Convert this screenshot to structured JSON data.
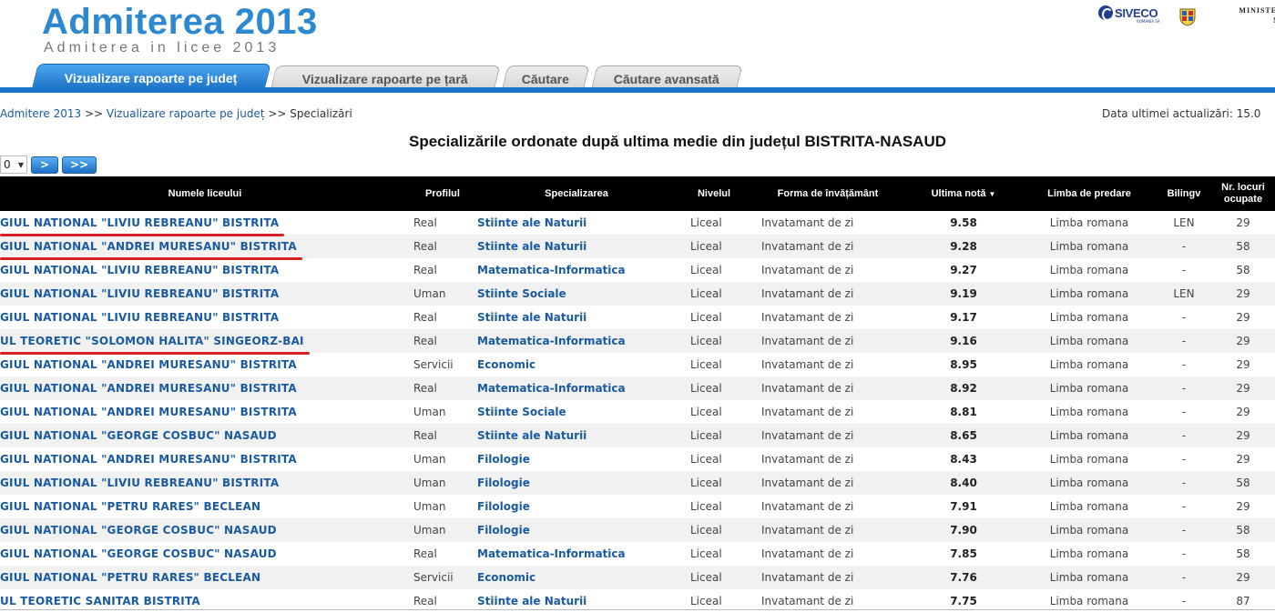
{
  "header": {
    "title": "Admiterea 2013",
    "subtitle": "Admiterea in licee 2013",
    "siveco": "SIVECO",
    "siveco_small": "ROMANIA SA",
    "ministry_line1": "MINISTERUL",
    "ministry_line2": "NAȚI"
  },
  "tabs": [
    {
      "label": "Vizualizare rapoarte pe județ",
      "active": true
    },
    {
      "label": "Vizualizare rapoarte pe țară",
      "active": false
    },
    {
      "label": "Căutare",
      "active": false
    },
    {
      "label": "Căutare avansată",
      "active": false
    }
  ],
  "breadcrumb": {
    "item1": "Admitere 2013",
    "sep": ">>",
    "item2": "Vizualizare rapoarte pe județ",
    "item3": "Specializări"
  },
  "last_update": "Data ultimei actualizări: 15.0",
  "heading": "Specializările ordonate după ultima medie din județul BISTRITA-NASAUD",
  "pager": {
    "page_value": "0",
    "next_label": ">",
    "last_label": ">>"
  },
  "table": {
    "headers": {
      "school": "Numele liceului",
      "profil": "Profilul",
      "spec": "Specializarea",
      "nivel": "Nivelul",
      "forma": "Forma de învățământ",
      "nota": "Ultima notă",
      "limba": "Limba de predare",
      "bilingv": "Bilingv",
      "locuri": "Nr. locuri ocupate"
    },
    "rows": [
      {
        "school": "GIUL NATIONAL \"LIVIU REBREANU\" BISTRITA",
        "profil": "Real",
        "spec": "Stiinte ale Naturii",
        "nivel": "Liceal",
        "forma": "Invatamant de zi",
        "nota": "9.58",
        "limba": "Limba romana",
        "bilingv": "LEN",
        "locuri": "29",
        "underlined": true
      },
      {
        "school": "GIUL NATIONAL \"ANDREI MURESANU\" BISTRITA",
        "profil": "Real",
        "spec": "Stiinte ale Naturii",
        "nivel": "Liceal",
        "forma": "Invatamant de zi",
        "nota": "9.28",
        "limba": "Limba romana",
        "bilingv": "-",
        "locuri": "58",
        "underlined": true
      },
      {
        "school": "GIUL NATIONAL \"LIVIU REBREANU\" BISTRITA",
        "profil": "Real",
        "spec": "Matematica-Informatica",
        "nivel": "Liceal",
        "forma": "Invatamant de zi",
        "nota": "9.27",
        "limba": "Limba romana",
        "bilingv": "-",
        "locuri": "58",
        "underlined": false
      },
      {
        "school": "GIUL NATIONAL \"LIVIU REBREANU\" BISTRITA",
        "profil": "Uman",
        "spec": "Stiinte Sociale",
        "nivel": "Liceal",
        "forma": "Invatamant de zi",
        "nota": "9.19",
        "limba": "Limba romana",
        "bilingv": "LEN",
        "locuri": "29",
        "underlined": false
      },
      {
        "school": "GIUL NATIONAL \"LIVIU REBREANU\" BISTRITA",
        "profil": "Real",
        "spec": "Stiinte ale Naturii",
        "nivel": "Liceal",
        "forma": "Invatamant de zi",
        "nota": "9.17",
        "limba": "Limba romana",
        "bilingv": "-",
        "locuri": "29",
        "underlined": false
      },
      {
        "school": "UL TEORETIC \"SOLOMON HALITA\" SINGEORZ-BAI",
        "profil": "Real",
        "spec": "Matematica-Informatica",
        "nivel": "Liceal",
        "forma": "Invatamant de zi",
        "nota": "9.16",
        "limba": "Limba romana",
        "bilingv": "-",
        "locuri": "29",
        "underlined": true
      },
      {
        "school": "GIUL NATIONAL \"ANDREI MURESANU\" BISTRITA",
        "profil": "Servicii",
        "spec": "Economic",
        "nivel": "Liceal",
        "forma": "Invatamant de zi",
        "nota": "8.95",
        "limba": "Limba romana",
        "bilingv": "-",
        "locuri": "29",
        "underlined": false
      },
      {
        "school": "GIUL NATIONAL \"ANDREI MURESANU\" BISTRITA",
        "profil": "Real",
        "spec": "Matematica-Informatica",
        "nivel": "Liceal",
        "forma": "Invatamant de zi",
        "nota": "8.92",
        "limba": "Limba romana",
        "bilingv": "-",
        "locuri": "29",
        "underlined": false
      },
      {
        "school": "GIUL NATIONAL \"ANDREI MURESANU\" BISTRITA",
        "profil": "Uman",
        "spec": "Stiinte Sociale",
        "nivel": "Liceal",
        "forma": "Invatamant de zi",
        "nota": "8.81",
        "limba": "Limba romana",
        "bilingv": "-",
        "locuri": "29",
        "underlined": false
      },
      {
        "school": "GIUL NATIONAL \"GEORGE COSBUC\" NASAUD",
        "profil": "Real",
        "spec": "Stiinte ale Naturii",
        "nivel": "Liceal",
        "forma": "Invatamant de zi",
        "nota": "8.65",
        "limba": "Limba romana",
        "bilingv": "-",
        "locuri": "29",
        "underlined": false
      },
      {
        "school": "GIUL NATIONAL \"ANDREI MURESANU\" BISTRITA",
        "profil": "Uman",
        "spec": "Filologie",
        "nivel": "Liceal",
        "forma": "Invatamant de zi",
        "nota": "8.43",
        "limba": "Limba romana",
        "bilingv": "-",
        "locuri": "29",
        "underlined": false
      },
      {
        "school": "GIUL NATIONAL \"LIVIU REBREANU\" BISTRITA",
        "profil": "Uman",
        "spec": "Filologie",
        "nivel": "Liceal",
        "forma": "Invatamant de zi",
        "nota": "8.40",
        "limba": "Limba romana",
        "bilingv": "-",
        "locuri": "58",
        "underlined": false
      },
      {
        "school": "GIUL NATIONAL \"PETRU RARES\" BECLEAN",
        "profil": "Uman",
        "spec": "Filologie",
        "nivel": "Liceal",
        "forma": "Invatamant de zi",
        "nota": "7.91",
        "limba": "Limba romana",
        "bilingv": "-",
        "locuri": "29",
        "underlined": false
      },
      {
        "school": "GIUL NATIONAL \"GEORGE COSBUC\" NASAUD",
        "profil": "Uman",
        "spec": "Filologie",
        "nivel": "Liceal",
        "forma": "Invatamant de zi",
        "nota": "7.90",
        "limba": "Limba romana",
        "bilingv": "-",
        "locuri": "58",
        "underlined": false
      },
      {
        "school": "GIUL NATIONAL \"GEORGE COSBUC\" NASAUD",
        "profil": "Real",
        "spec": "Matematica-Informatica",
        "nivel": "Liceal",
        "forma": "Invatamant de zi",
        "nota": "7.85",
        "limba": "Limba romana",
        "bilingv": "-",
        "locuri": "58",
        "underlined": false
      },
      {
        "school": "GIUL NATIONAL \"PETRU RARES\" BECLEAN",
        "profil": "Servicii",
        "spec": "Economic",
        "nivel": "Liceal",
        "forma": "Invatamant de zi",
        "nota": "7.76",
        "limba": "Limba romana",
        "bilingv": "-",
        "locuri": "29",
        "underlined": false
      },
      {
        "school": "UL TEORETIC SANITAR BISTRITA",
        "profil": "Real",
        "spec": "Stiinte ale Naturii",
        "nivel": "Liceal",
        "forma": "Invatamant de zi",
        "nota": "7.75",
        "limba": "Limba romana",
        "bilingv": "-",
        "locuri": "87",
        "underlined": false
      }
    ]
  },
  "colors": {
    "accent": "#1a73c9",
    "link": "#1a5aa0",
    "title": "#2d88d2",
    "highlight_underline": "#d62020"
  }
}
